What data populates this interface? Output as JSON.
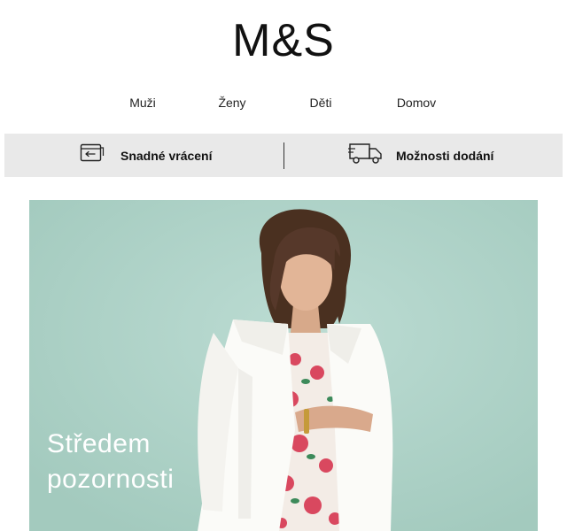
{
  "brand": {
    "logo_text": "M&S"
  },
  "nav": {
    "items": [
      {
        "label": "Muži"
      },
      {
        "label": "Ženy"
      },
      {
        "label": "Děti"
      },
      {
        "label": "Domov"
      }
    ]
  },
  "infobar": {
    "returns_label": "Snadné vrácení",
    "returns_icon": "return-card-icon",
    "delivery_label": "Možnosti dodání",
    "delivery_icon": "delivery-truck-icon"
  },
  "hero": {
    "headline_line1": "Středem",
    "headline_line2": "pozornosti",
    "image": "woman-in-white-blazer-floral-dress",
    "background_color": "#aed2c8"
  }
}
